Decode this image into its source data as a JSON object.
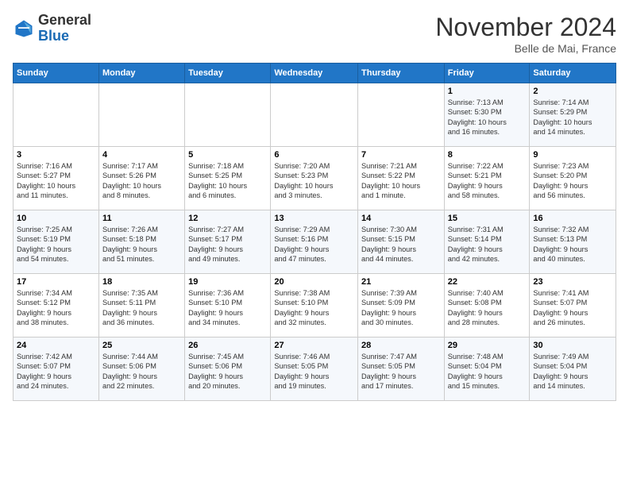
{
  "header": {
    "logo_general": "General",
    "logo_blue": "Blue",
    "month_title": "November 2024",
    "location": "Belle de Mai, France"
  },
  "weekdays": [
    "Sunday",
    "Monday",
    "Tuesday",
    "Wednesday",
    "Thursday",
    "Friday",
    "Saturday"
  ],
  "weeks": [
    [
      {
        "day": "",
        "info": ""
      },
      {
        "day": "",
        "info": ""
      },
      {
        "day": "",
        "info": ""
      },
      {
        "day": "",
        "info": ""
      },
      {
        "day": "",
        "info": ""
      },
      {
        "day": "1",
        "info": "Sunrise: 7:13 AM\nSunset: 5:30 PM\nDaylight: 10 hours\nand 16 minutes."
      },
      {
        "day": "2",
        "info": "Sunrise: 7:14 AM\nSunset: 5:29 PM\nDaylight: 10 hours\nand 14 minutes."
      }
    ],
    [
      {
        "day": "3",
        "info": "Sunrise: 7:16 AM\nSunset: 5:27 PM\nDaylight: 10 hours\nand 11 minutes."
      },
      {
        "day": "4",
        "info": "Sunrise: 7:17 AM\nSunset: 5:26 PM\nDaylight: 10 hours\nand 8 minutes."
      },
      {
        "day": "5",
        "info": "Sunrise: 7:18 AM\nSunset: 5:25 PM\nDaylight: 10 hours\nand 6 minutes."
      },
      {
        "day": "6",
        "info": "Sunrise: 7:20 AM\nSunset: 5:23 PM\nDaylight: 10 hours\nand 3 minutes."
      },
      {
        "day": "7",
        "info": "Sunrise: 7:21 AM\nSunset: 5:22 PM\nDaylight: 10 hours\nand 1 minute."
      },
      {
        "day": "8",
        "info": "Sunrise: 7:22 AM\nSunset: 5:21 PM\nDaylight: 9 hours\nand 58 minutes."
      },
      {
        "day": "9",
        "info": "Sunrise: 7:23 AM\nSunset: 5:20 PM\nDaylight: 9 hours\nand 56 minutes."
      }
    ],
    [
      {
        "day": "10",
        "info": "Sunrise: 7:25 AM\nSunset: 5:19 PM\nDaylight: 9 hours\nand 54 minutes."
      },
      {
        "day": "11",
        "info": "Sunrise: 7:26 AM\nSunset: 5:18 PM\nDaylight: 9 hours\nand 51 minutes."
      },
      {
        "day": "12",
        "info": "Sunrise: 7:27 AM\nSunset: 5:17 PM\nDaylight: 9 hours\nand 49 minutes."
      },
      {
        "day": "13",
        "info": "Sunrise: 7:29 AM\nSunset: 5:16 PM\nDaylight: 9 hours\nand 47 minutes."
      },
      {
        "day": "14",
        "info": "Sunrise: 7:30 AM\nSunset: 5:15 PM\nDaylight: 9 hours\nand 44 minutes."
      },
      {
        "day": "15",
        "info": "Sunrise: 7:31 AM\nSunset: 5:14 PM\nDaylight: 9 hours\nand 42 minutes."
      },
      {
        "day": "16",
        "info": "Sunrise: 7:32 AM\nSunset: 5:13 PM\nDaylight: 9 hours\nand 40 minutes."
      }
    ],
    [
      {
        "day": "17",
        "info": "Sunrise: 7:34 AM\nSunset: 5:12 PM\nDaylight: 9 hours\nand 38 minutes."
      },
      {
        "day": "18",
        "info": "Sunrise: 7:35 AM\nSunset: 5:11 PM\nDaylight: 9 hours\nand 36 minutes."
      },
      {
        "day": "19",
        "info": "Sunrise: 7:36 AM\nSunset: 5:10 PM\nDaylight: 9 hours\nand 34 minutes."
      },
      {
        "day": "20",
        "info": "Sunrise: 7:38 AM\nSunset: 5:10 PM\nDaylight: 9 hours\nand 32 minutes."
      },
      {
        "day": "21",
        "info": "Sunrise: 7:39 AM\nSunset: 5:09 PM\nDaylight: 9 hours\nand 30 minutes."
      },
      {
        "day": "22",
        "info": "Sunrise: 7:40 AM\nSunset: 5:08 PM\nDaylight: 9 hours\nand 28 minutes."
      },
      {
        "day": "23",
        "info": "Sunrise: 7:41 AM\nSunset: 5:07 PM\nDaylight: 9 hours\nand 26 minutes."
      }
    ],
    [
      {
        "day": "24",
        "info": "Sunrise: 7:42 AM\nSunset: 5:07 PM\nDaylight: 9 hours\nand 24 minutes."
      },
      {
        "day": "25",
        "info": "Sunrise: 7:44 AM\nSunset: 5:06 PM\nDaylight: 9 hours\nand 22 minutes."
      },
      {
        "day": "26",
        "info": "Sunrise: 7:45 AM\nSunset: 5:06 PM\nDaylight: 9 hours\nand 20 minutes."
      },
      {
        "day": "27",
        "info": "Sunrise: 7:46 AM\nSunset: 5:05 PM\nDaylight: 9 hours\nand 19 minutes."
      },
      {
        "day": "28",
        "info": "Sunrise: 7:47 AM\nSunset: 5:05 PM\nDaylight: 9 hours\nand 17 minutes."
      },
      {
        "day": "29",
        "info": "Sunrise: 7:48 AM\nSunset: 5:04 PM\nDaylight: 9 hours\nand 15 minutes."
      },
      {
        "day": "30",
        "info": "Sunrise: 7:49 AM\nSunset: 5:04 PM\nDaylight: 9 hours\nand 14 minutes."
      }
    ]
  ]
}
